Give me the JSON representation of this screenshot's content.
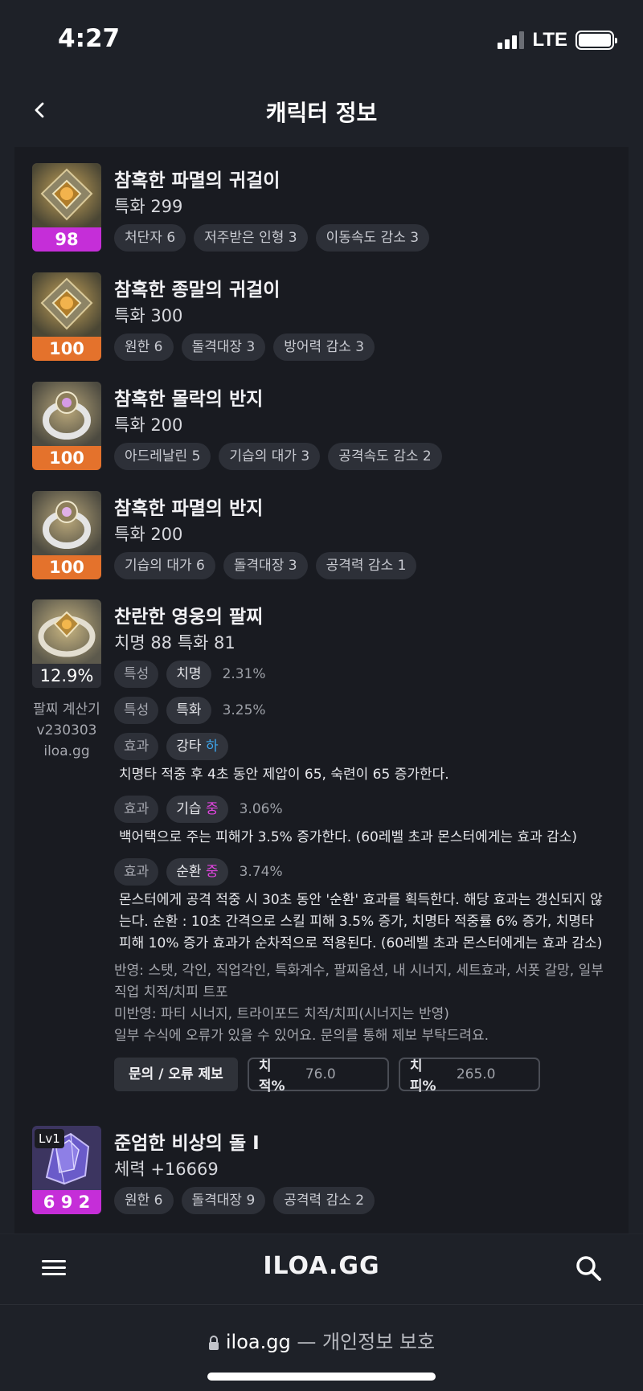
{
  "status_bar": {
    "time": "4:27",
    "network": "LTE"
  },
  "header": {
    "title": "캐릭터 정보"
  },
  "accessories": [
    {
      "name": "참혹한 파멸의 귀걸이",
      "stat": "특화 299",
      "quality": "98",
      "quality_color": "#c52ed8",
      "engravings": [
        "처단자 6",
        "저주받은 인형 3",
        "이동속도 감소 3"
      ]
    },
    {
      "name": "참혹한 종말의 귀걸이",
      "stat": "특화 300",
      "quality": "100",
      "quality_color": "#e4722c",
      "engravings": [
        "원한 6",
        "돌격대장 3",
        "방어력 감소 3"
      ]
    },
    {
      "name": "참혹한 몰락의 반지",
      "stat": "특화 200",
      "quality": "100",
      "quality_color": "#e4722c",
      "engravings": [
        "아드레날린 5",
        "기습의 대가 3",
        "공격속도 감소 2"
      ]
    },
    {
      "name": "참혹한 파멸의 반지",
      "stat": "특화 200",
      "quality": "100",
      "quality_color": "#e4722c",
      "engravings": [
        "기습의 대가 6",
        "돌격대장 3",
        "공격력 감소 1"
      ]
    }
  ],
  "bracelet": {
    "name": "찬란한 영웅의 팔찌",
    "stat": "치명 88  특화 81",
    "quality": "12.9%",
    "calc_label": [
      "팔찌 계산기",
      "v230303",
      "iloa.gg"
    ],
    "rows": [
      {
        "kind": "특성",
        "label": "치명",
        "grade": "",
        "value": "2.31%"
      },
      {
        "kind": "특성",
        "label": "특화",
        "grade": "",
        "value": "3.25%"
      },
      {
        "kind": "효과",
        "label": "강타",
        "grade": "하",
        "value": "",
        "desc": "치명타 적중 후 4초 동안 제압이 65, 숙련이 65 증가한다."
      },
      {
        "kind": "효과",
        "label": "기습",
        "grade": "중",
        "value": "3.06%",
        "desc": "백어택으로 주는 피해가 3.5% 증가한다. (60레벨 초과 몬스터에게는 효과 감소)"
      },
      {
        "kind": "효과",
        "label": "순환",
        "grade": "중",
        "value": "3.74%",
        "desc": "몬스터에게 공격 적중 시 30초 동안 '순환' 효과를 획득한다. 해당 효과는 갱신되지 않는다. 순환 : 10초 간격으로 스킬 피해 3.5% 증가, 치명타 적중률 6% 증가, 치명타 피해 10% 증가 효과가 순차적으로 적용된다. (60레벨 초과 몬스터에게는 효과 감소)"
      }
    ],
    "note_reflected": "반영: 스탯, 각인, 직업각인, 특화계수, 팔찌옵션, 내 시너지, 세트효과, 서폿 갈망, 일부 직업 치적/치피 트포",
    "note_unreflected": "미반영: 파티 시너지, 트라이포드 치적/치피(시너지는 반영)",
    "note_error": "일부 수식에 오류가 있을 수 있어요. 문의를 통해 제보 부탁드려요.",
    "report_button": "문의 / 오류 제보",
    "crit_rate_label": "치적%",
    "crit_rate_value": "76.0",
    "crit_dmg_label": "치피%",
    "crit_dmg_value": "265.0"
  },
  "stone": {
    "name": "준엄한 비상의 돌 I",
    "stat": "체력 +16669",
    "level": "Lv1",
    "quality": "6 9 2",
    "engravings": [
      "원한 6",
      "돌격대장 9",
      "공격력 감소 2"
    ]
  },
  "bottom_nav": {
    "logo": "ILOA.GG"
  },
  "url_bar": {
    "domain": "iloa.gg",
    "suffix": " — 개인정보 보호"
  },
  "colors": {
    "background": "#1e2128",
    "panel": "#191b21",
    "quality_purple": "#c52ed8",
    "quality_orange": "#e4722c",
    "grade_low": "#3ea7ee",
    "grade_mid": "#e145df"
  }
}
